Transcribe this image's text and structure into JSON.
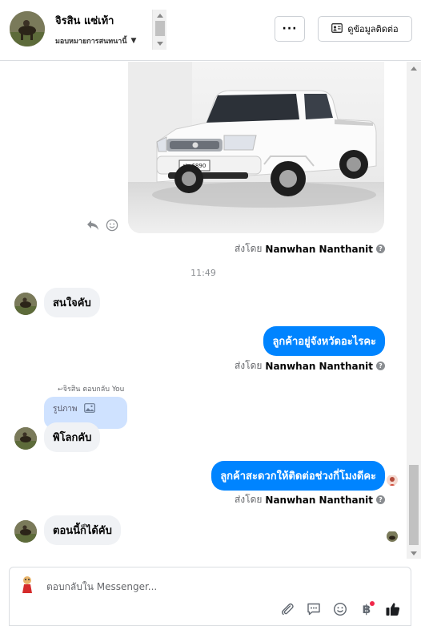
{
  "header": {
    "contact_name": "จิรสิน แซ่เท้า",
    "assign_label": "มอบหมายการสนทนานี้",
    "more_label": "···",
    "view_contact_label": "ดูข้อมูลติดต่อ"
  },
  "thread": {
    "sent_by_prefix": "ส่งโดย",
    "sender_name": "Nanwhan Nanthanit",
    "timestamp": "11:49",
    "photo_plate": "ปย 6890",
    "messages": [
      {
        "direction": "in",
        "text": "สนใจคับ"
      },
      {
        "direction": "out",
        "text": "ลูกค้าอยู่จังหวัดอะไรคะ"
      },
      {
        "direction": "in",
        "text": "พิโลกคับ",
        "reply_label": "จิรสิน ตอบกลับ You",
        "reply_quote": "รูปภาพ"
      },
      {
        "direction": "out",
        "text": "ลูกค้าสะดวกให้ติดต่อช่วงกี่โมงดีคะ"
      },
      {
        "direction": "in",
        "text": "ตอนนี้ก็ได้คับ"
      }
    ]
  },
  "composer": {
    "placeholder": "ตอบกลับใน Messenger..."
  },
  "colors": {
    "accent": "#0084ff",
    "incoming_bubble": "#f0f2f5",
    "reply_quote": "#cfe2ff"
  }
}
